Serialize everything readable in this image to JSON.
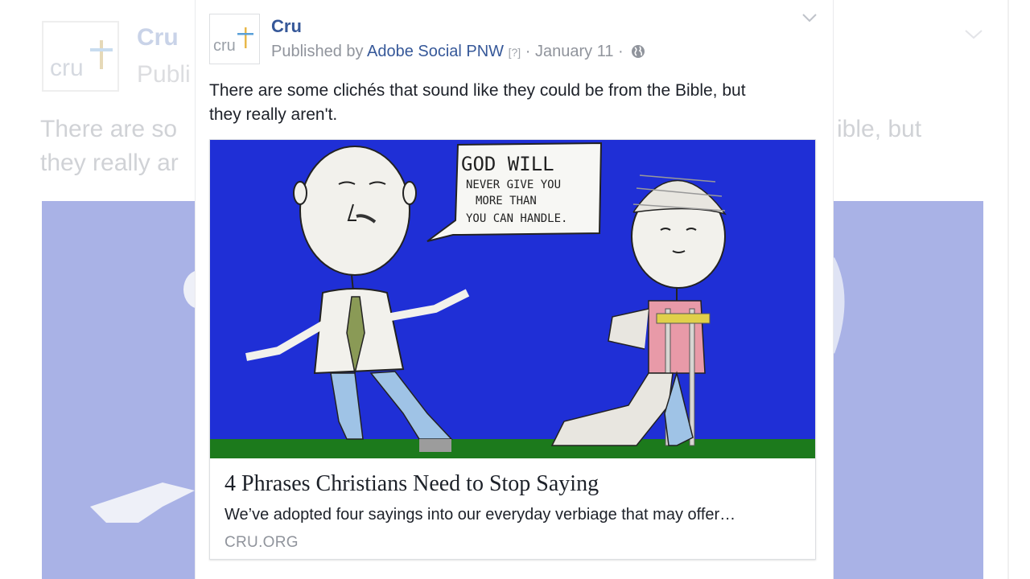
{
  "background": {
    "logo_text": "cru",
    "name": "Cru",
    "published_partial": "Publi",
    "text_line1_partial": "There are so",
    "text_line1_end": "ible, but",
    "text_line2_partial": "they really ar"
  },
  "post": {
    "page_name": "Cru",
    "avatar_text": "cru",
    "published_prefix": "Published by",
    "publisher": "Adobe Social PNW",
    "help_marker": "[?]",
    "separator": "·",
    "date": "January 11",
    "privacy_icon": "globe-icon",
    "options_icon": "chevron-down-icon",
    "text_line1": "There are some clichés that sound like they could be from the Bible, but",
    "text_line2": "they really aren't."
  },
  "link_preview": {
    "image": {
      "speech_bubble": [
        "GOD WILL",
        "NEVER GIVE YOU",
        "MORE THAN",
        "YOU CAN HANDLE."
      ],
      "background_color": "#1f2fd6",
      "ground_color": "#1c7a1c"
    },
    "title": "4 Phrases Christians Need to Stop Saying",
    "description": "We’ve adopted four sayings into our everyday verbiage that may offer…",
    "domain": "CRU.ORG"
  },
  "colors": {
    "link_blue": "#365899",
    "meta_gray": "#90949c",
    "text": "#1d2129",
    "cru_blue": "#5aa0d8",
    "cru_gold": "#e8b84a"
  }
}
